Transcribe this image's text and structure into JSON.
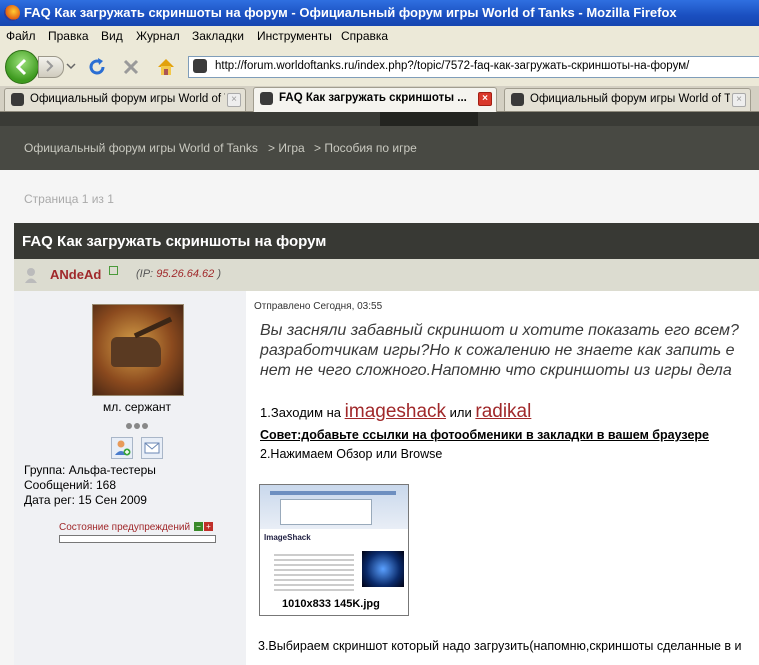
{
  "window": {
    "title": "FAQ Как загружать скриншоты на форум - Официальный форум игры World of Tanks - Mozilla Firefox"
  },
  "menu": [
    "Файл",
    "Правка",
    "Вид",
    "Журнал",
    "Закладки",
    "Инструменты",
    "Справка"
  ],
  "nav": {
    "url": "http://forum.worldoftanks.ru/index.php?/topic/7572-faq-как-загружать-скриншоты-на-форум/"
  },
  "tabs": [
    {
      "label": "Официальный форум игры World of T...",
      "active": false
    },
    {
      "label": "FAQ Как загружать скриншоты ...",
      "active": true
    },
    {
      "label": "Официальный форум игры World of T...",
      "active": false
    }
  ],
  "breadcrumb": {
    "items": [
      "Официальный форум игры World of Tanks",
      "> Игра",
      "> Пособия по игре"
    ]
  },
  "pagination": {
    "text": "Страница 1 из 1"
  },
  "topic": {
    "title": "FAQ Как загружать скриншоты на форум"
  },
  "author": {
    "name": "ANdeAd",
    "ip_label": "(IP:",
    "ip": "95.26.64.62",
    "ip_close": ")"
  },
  "profile": {
    "rank": "мл. сержант",
    "group": "Группа: Альфа-тестеры",
    "posts": "Сообщений: 168",
    "reg": "Дата рег: 15 Сен 2009",
    "warn_label": "Состояние предупреждений",
    "warn_minus": "−",
    "warn_plus": "+"
  },
  "post": {
    "posted": "Отправлено Сегодня, 03:55",
    "intro": [
      "Вы засняли забавный скриншот и хотите показать его всем?",
      "разработчикам игры?Но к сожалению не знаете как запить е",
      "нет не чего сложного.Напомню что скриншоты из игры дела"
    ],
    "step1_prefix": "1.Заходим на ",
    "link1": "imageshack",
    "step1_or": " или ",
    "link2": "radikal",
    "tip": "Совет:добавьте ссылки на фотообменики в закладки в вашем браузере",
    "step2": "2.Нажимаем Обзор или Browse",
    "thumb_logo": "ImageShack",
    "thumb_caption": "1010x833 145K.jpg",
    "step3": "3.Выбираем скриншот который надо загрузить(напомню,скриншоты сделанные в и"
  },
  "colors": {
    "accent": "#a0282a",
    "header": "#383934"
  }
}
